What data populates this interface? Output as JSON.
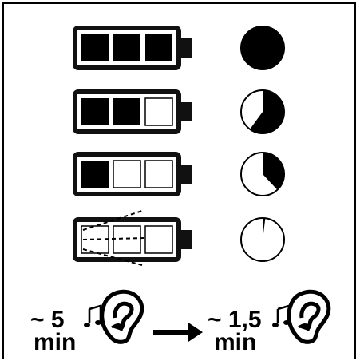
{
  "battery_levels": [
    {
      "filled_cells": 3,
      "total_cells": 3,
      "remaining_fraction": 1.0
    },
    {
      "filled_cells": 2,
      "total_cells": 3,
      "remaining_fraction": 0.6
    },
    {
      "filled_cells": 1,
      "total_cells": 3,
      "remaining_fraction": 0.38
    },
    {
      "filled_cells": 0,
      "total_cells": 3,
      "remaining_fraction": 0.02
    }
  ],
  "before": {
    "time": "~ 5",
    "unit": "min"
  },
  "after": {
    "time": "~ 1,5",
    "unit": "min"
  },
  "icons": {
    "music": "music-note-icon",
    "ear": "ear-icon",
    "arrow": "arrow-right-icon"
  },
  "colors": {
    "ink": "#000000",
    "paper": "#ffffff"
  }
}
